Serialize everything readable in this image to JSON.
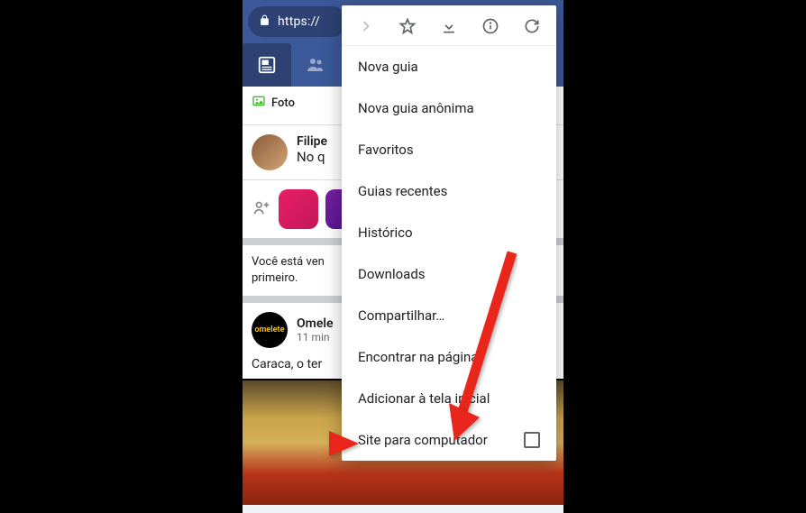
{
  "url_bar": {
    "url_text": "https://"
  },
  "composer": {
    "photo_label": "Foto"
  },
  "user_post": {
    "name": "Filipe",
    "text": "No q"
  },
  "feed_notice": {
    "line1": "Você está ven",
    "line2": "primeiro."
  },
  "feed_post": {
    "page_name": "Omele",
    "page_avatar_text": "omelete",
    "time": "11 min",
    "text": "Caraca, o ter"
  },
  "chrome_menu": {
    "items": [
      "Nova guia",
      "Nova guia anônima",
      "Favoritos",
      "Guias recentes",
      "Histórico",
      "Downloads",
      "Compartilhar…",
      "Encontrar na página",
      "Adicionar à tela inicial",
      "Site para computador"
    ]
  }
}
